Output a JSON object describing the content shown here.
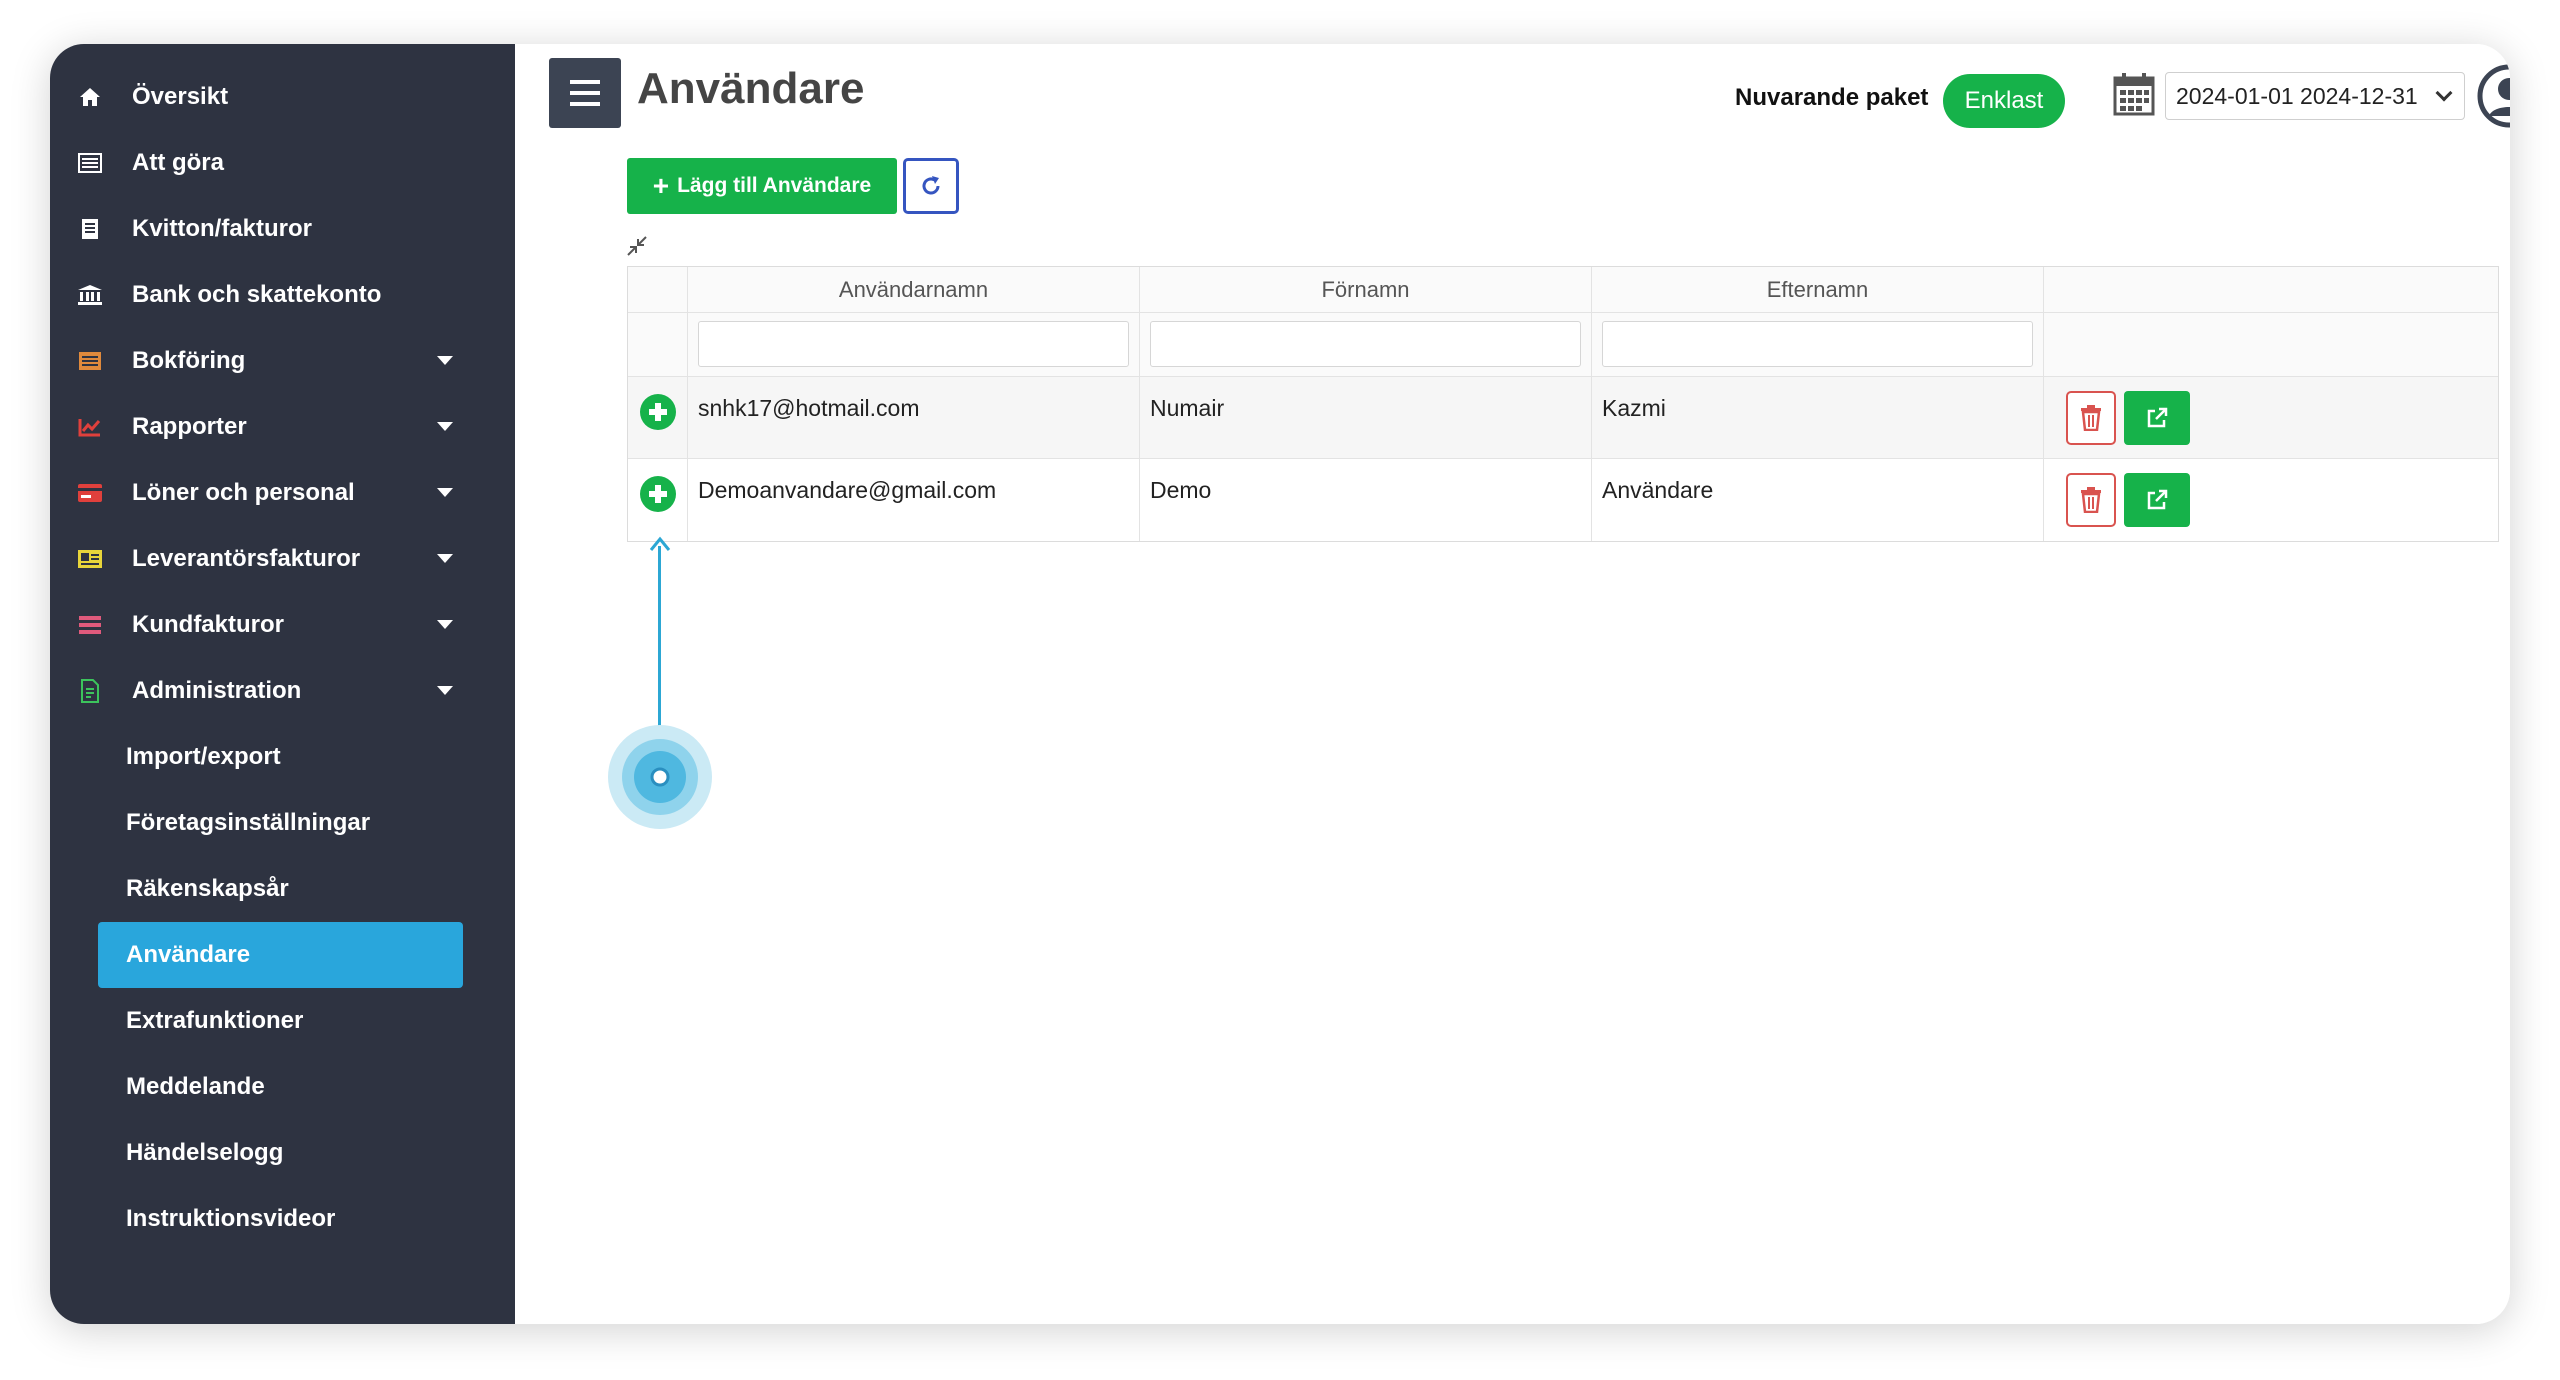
{
  "sidebar": {
    "items": [
      {
        "label": "Översikt",
        "icon": "home-icon"
      },
      {
        "label": "Att göra",
        "icon": "list-icon"
      },
      {
        "label": "Kvitton/fakturor",
        "icon": "receipt-icon"
      },
      {
        "label": "Bank och skattekonto",
        "icon": "bank-icon"
      },
      {
        "label": "Bokföring",
        "icon": "ledger-icon"
      },
      {
        "label": "Rapporter",
        "icon": "chart-icon"
      },
      {
        "label": "Löner och personal",
        "icon": "card-icon"
      },
      {
        "label": "Leverantörsfakturor",
        "icon": "invoice-icon"
      },
      {
        "label": "Kundfakturor",
        "icon": "customer-invoice-icon"
      },
      {
        "label": "Administration",
        "icon": "admin-icon"
      }
    ],
    "sub_items": [
      {
        "label": "Import/export"
      },
      {
        "label": "Företagsinställningar"
      },
      {
        "label": "Räkenskapsår"
      },
      {
        "label": "Användare"
      },
      {
        "label": "Extrafunktioner"
      },
      {
        "label": "Meddelande"
      },
      {
        "label": "Händelselogg"
      },
      {
        "label": "Instruktionsvideor"
      }
    ]
  },
  "header": {
    "title": "Användare",
    "package_label": "Nuvarande paket",
    "package_value": "Enklast",
    "date_range": "2024-01-01 2024-12-31"
  },
  "toolbar": {
    "add_label": "Lägg till Användare"
  },
  "table": {
    "columns": [
      "Användarnamn",
      "Förnamn",
      "Efternamn"
    ],
    "rows": [
      {
        "username": "snhk17@hotmail.com",
        "first_name": "Numair",
        "last_name": "Kazmi"
      },
      {
        "username": "Demoanvandare@gmail.com",
        "first_name": "Demo",
        "last_name": "Användare"
      }
    ]
  },
  "colors": {
    "sidebar_bg": "#2e3341",
    "active_item": "#29a6dc",
    "primary_green": "#16b24a",
    "delete_red": "#d9534f",
    "refresh_blue": "#3555c0"
  }
}
